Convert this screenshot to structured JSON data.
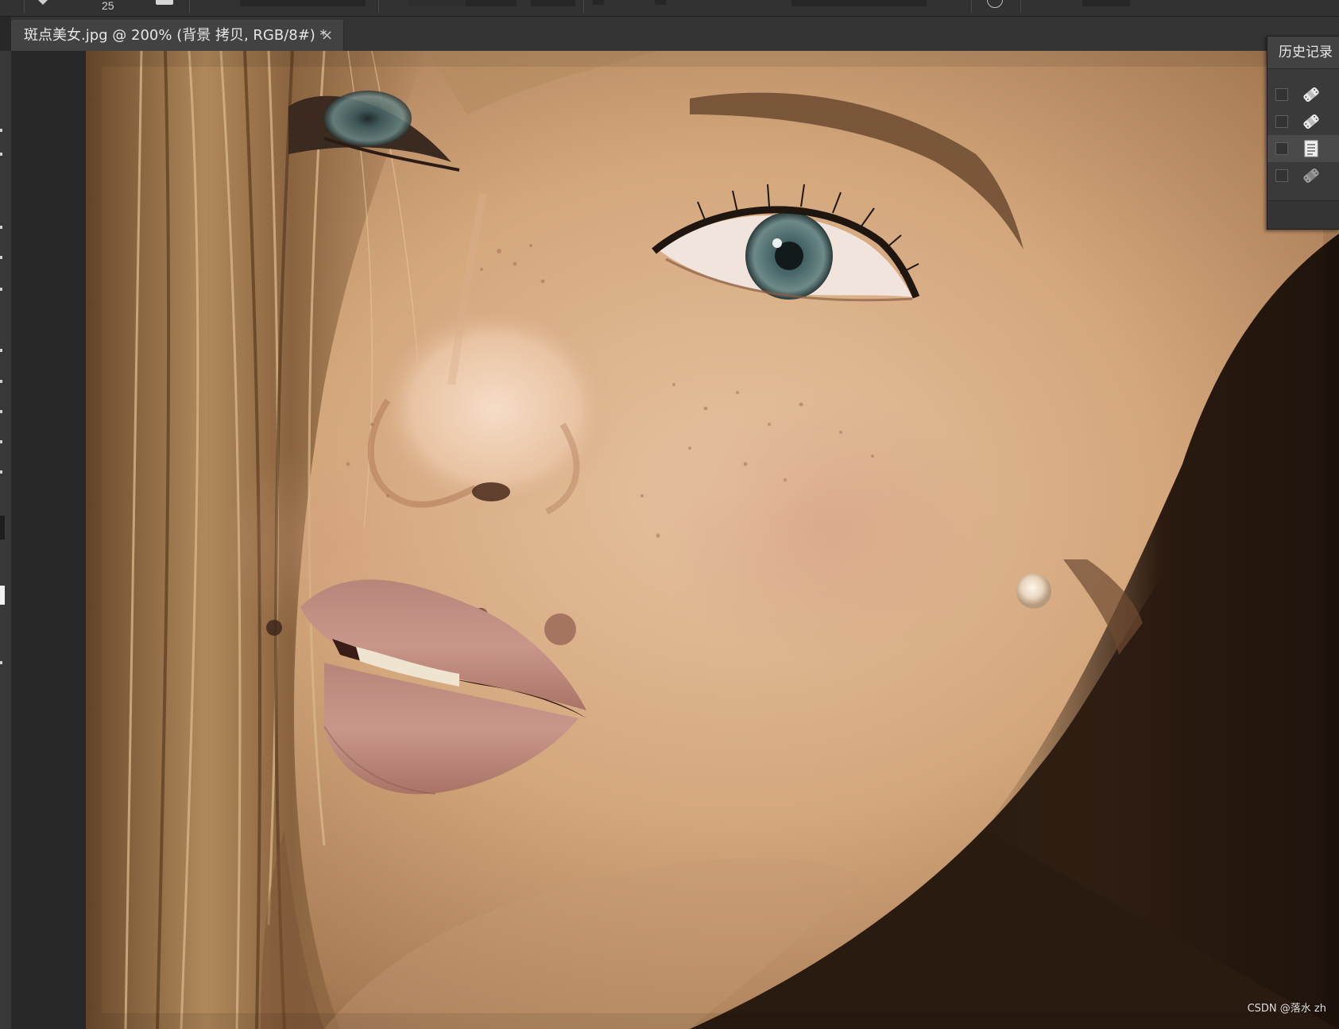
{
  "options_bar": {
    "brush_size": "25",
    "icons": [
      "brush-preset-arrow-icon",
      "brush-settings-icon",
      "sample-circle-icon"
    ]
  },
  "document_tab": {
    "title": "斑点美女.jpg @ 200% (背景 拷贝, RGB/8#) *",
    "close_glyph": "×"
  },
  "history_panel": {
    "title": "历史记录",
    "steps": [
      {
        "icon": "spot-healing-brush-icon",
        "selected": false
      },
      {
        "icon": "spot-healing-brush-icon",
        "selected": false
      },
      {
        "icon": "document-icon",
        "selected": true
      },
      {
        "icon": "spot-healing-brush-icon",
        "selected": false
      }
    ]
  },
  "canvas": {
    "subject": "close-up portrait photo",
    "watermark": "CSDN @落水 zh"
  },
  "colors": {
    "ui_background": "#282828",
    "panel": "#3a3a3a",
    "tab_active": "#424242",
    "text": "#e6e6e6"
  }
}
